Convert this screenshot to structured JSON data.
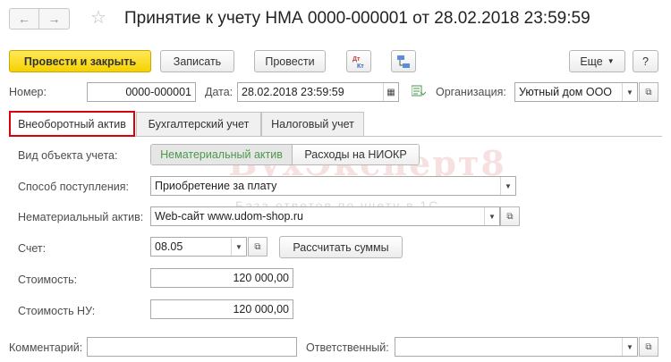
{
  "header": {
    "back_icon": "arrow-left-icon",
    "forward_icon": "arrow-right-icon",
    "favorite_icon": "star-icon",
    "title": "Принятие к учету НМА 0000-000001 от 28.02.2018 23:59:59"
  },
  "toolbar": {
    "post_close": "Провести и закрыть",
    "save": "Записать",
    "post": "Провести",
    "dtkt_icon": "Дт\nКт",
    "more": "Еще",
    "help": "?"
  },
  "doc": {
    "number_label": "Номер:",
    "number_value": "0000-000001",
    "date_label": "Дата:",
    "date_value": "28.02.2018 23:59:59",
    "org_label": "Организация:",
    "org_value": "Уютный дом ООО"
  },
  "tabs": [
    {
      "label": "Внеоборотный актив",
      "active": true
    },
    {
      "label": "Бухгалтерский учет",
      "active": false
    },
    {
      "label": "Налоговый учет",
      "active": false
    }
  ],
  "form": {
    "object_type_label": "Вид объекта учета:",
    "object_type_options": [
      "Нематериальный актив",
      "Расходы на НИОКР"
    ],
    "receipt_label": "Способ поступления:",
    "receipt_value": "Приобретение за плату",
    "asset_label": "Нематериальный актив:",
    "asset_value": "Web-сайт www.udom-shop.ru",
    "account_label": "Счет:",
    "account_value": "08.05",
    "calc_button": "Рассчитать суммы",
    "cost_label": "Стоимость:",
    "cost_value": "120 000,00",
    "cost_tax_label": "Стоимость НУ:",
    "cost_tax_value": "120 000,00"
  },
  "footer": {
    "comment_label": "Комментарий:",
    "comment_value": "",
    "responsible_label": "Ответственный:",
    "responsible_value": ""
  },
  "watermark": {
    "brand": "БухЭксперт8",
    "tagline": "База ответов по учету в 1С"
  },
  "colors": {
    "primary_button": "#f6d200",
    "active_tab_border": "#d9000d",
    "toggle_selected_text": "#4a9a4a"
  }
}
